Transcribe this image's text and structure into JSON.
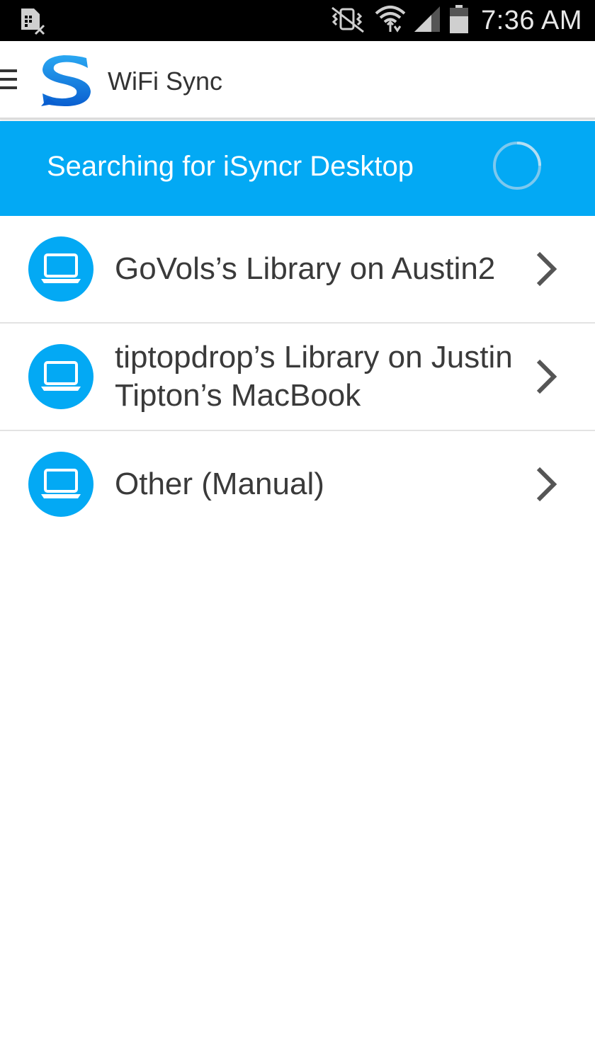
{
  "status_bar": {
    "time": "7:36 AM",
    "icons": [
      "sim-icon",
      "mute-vibrate-icon",
      "wifi-icon",
      "signal-icon",
      "battery-icon"
    ]
  },
  "action_bar": {
    "title": "WiFi Sync",
    "icons": [
      "menu-icon",
      "isyncr-logo"
    ]
  },
  "banner": {
    "text": "Searching for iSyncr Desktop",
    "color": "#03a9f4"
  },
  "libraries": [
    {
      "label": "GoVols’s Library on Austin2",
      "icon": "laptop-icon"
    },
    {
      "label": "tiptopdrop’s Library on Justin Tipton’s MacBook",
      "icon": "laptop-icon"
    },
    {
      "label": "Other (Manual)",
      "icon": "laptop-icon"
    }
  ]
}
